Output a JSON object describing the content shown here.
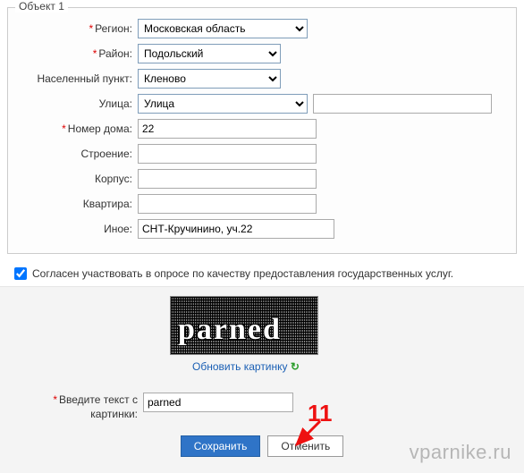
{
  "fieldset": {
    "legend": "Объект 1",
    "rows": {
      "region": {
        "label": "Регион:",
        "required": true,
        "value": "Московская область"
      },
      "rayon": {
        "label": "Район:",
        "required": true,
        "value": "Подольский"
      },
      "np": {
        "label": "Населенный пункт:",
        "required": false,
        "value": "Кленово"
      },
      "ulica": {
        "label": "Улица:",
        "required": false,
        "value": "Улица",
        "extra": ""
      },
      "house": {
        "label": "Номер дома:",
        "required": true,
        "value": "22"
      },
      "stroenie": {
        "label": "Строение:",
        "required": false,
        "value": ""
      },
      "korpus": {
        "label": "Корпус:",
        "required": false,
        "value": ""
      },
      "kvartira": {
        "label": "Квартира:",
        "required": false,
        "value": ""
      },
      "inoe": {
        "label": "Иное:",
        "required": false,
        "value": "СНТ-Кручинино, уч.22"
      }
    }
  },
  "survey": {
    "checked": true,
    "label": "Согласен участвовать в опросе по качеству предоставления государственных услуг."
  },
  "captcha": {
    "word": "parned",
    "refresh_label": "Обновить картинку",
    "input_label_line1": "Введите текст с",
    "input_label_line2": "картинки:",
    "required": true,
    "input_value": "parned"
  },
  "buttons": {
    "save": "Сохранить",
    "cancel": "Отменить"
  },
  "annotation": {
    "number": "11"
  },
  "watermark": "vparnike.ru"
}
